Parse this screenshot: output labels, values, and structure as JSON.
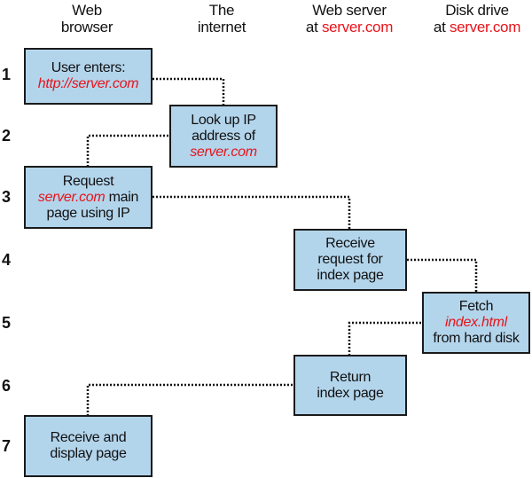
{
  "columns": [
    {
      "line1": "Web",
      "line2": "browser",
      "line2_red": ""
    },
    {
      "line1": "The",
      "line2": "internet",
      "line2_red": ""
    },
    {
      "line1": "Web server",
      "line2": "at ",
      "line2_red": "server.com"
    },
    {
      "line1": "Disk drive",
      "line2": "at ",
      "line2_red": "server.com"
    }
  ],
  "steps": [
    "1",
    "2",
    "3",
    "4",
    "5",
    "6",
    "7"
  ],
  "boxes": [
    {
      "step": "1",
      "column": "Web browser",
      "lines": [
        {
          "text": "User enters:"
        },
        {
          "text": "http://server.com",
          "highlight": true
        }
      ]
    },
    {
      "step": "2",
      "column": "The internet",
      "lines": [
        {
          "text": "Look up IP"
        },
        {
          "text": "address of"
        },
        {
          "text": "server.com",
          "highlight": true
        }
      ]
    },
    {
      "step": "3",
      "column": "Web browser",
      "lines": [
        {
          "text": "Request"
        },
        {
          "text_red": "server.com",
          "text_after": " main"
        },
        {
          "text": "page using IP"
        }
      ]
    },
    {
      "step": "4",
      "column": "Web server",
      "lines": [
        {
          "text": "Receive"
        },
        {
          "text": "request for"
        },
        {
          "text": "index page"
        }
      ]
    },
    {
      "step": "5",
      "column": "Disk drive",
      "lines": [
        {
          "text": "Fetch"
        },
        {
          "text": "index.html",
          "highlight": true
        },
        {
          "text": "from hard disk"
        }
      ]
    },
    {
      "step": "6",
      "column": "Web server",
      "lines": [
        {
          "text": "Return"
        },
        {
          "text": "index page"
        }
      ]
    },
    {
      "step": "7",
      "column": "Web browser",
      "lines": [
        {
          "text": "Receive and"
        },
        {
          "text": "display page"
        }
      ]
    }
  ],
  "colors": {
    "box_fill": "#b3d5ec",
    "highlight": "#e8141b",
    "border": "#1a1a1a"
  }
}
